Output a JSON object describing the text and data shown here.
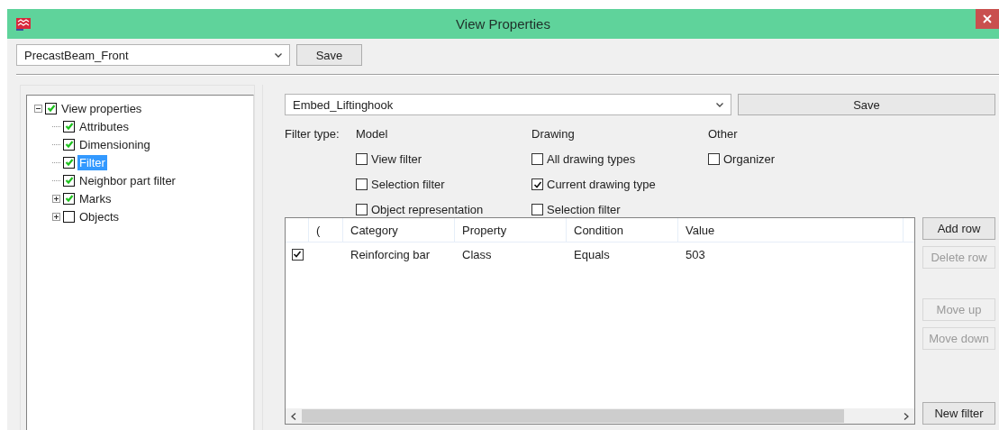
{
  "window": {
    "title": "View Properties"
  },
  "view_selector": {
    "value": "PrecastBeam_Front",
    "save": "Save"
  },
  "tree": [
    {
      "label": "View properties",
      "checked": true,
      "selected": false,
      "expanded": true,
      "children": [
        {
          "label": "Attributes",
          "checked": true,
          "selected": false
        },
        {
          "label": "Dimensioning",
          "checked": true,
          "selected": false
        },
        {
          "label": "Filter",
          "checked": true,
          "selected": true
        },
        {
          "label": "Neighbor part filter",
          "checked": true,
          "selected": false
        },
        {
          "label": "Marks",
          "checked": true,
          "selected": false,
          "expanded": false
        },
        {
          "label": "Objects",
          "checked": false,
          "selected": false,
          "expanded": false
        }
      ]
    }
  ],
  "filter_selector": {
    "value": "Embed_Liftinghook",
    "save": "Save"
  },
  "filter_type": {
    "label": "Filter type:",
    "groups": [
      {
        "heading": "Model",
        "options": [
          {
            "label": "View filter",
            "checked": false
          },
          {
            "label": "Selection filter",
            "checked": false
          },
          {
            "label": "Object representation",
            "checked": false
          }
        ]
      },
      {
        "heading": "Drawing",
        "options": [
          {
            "label": "All drawing types",
            "checked": false
          },
          {
            "label": "Current drawing type",
            "checked": true
          },
          {
            "label": "Selection filter",
            "checked": false
          }
        ]
      },
      {
        "heading": "Other",
        "options": [
          {
            "label": "Organizer",
            "checked": false
          }
        ]
      }
    ]
  },
  "table": {
    "columns": [
      "(",
      "Category",
      "Property",
      "Condition",
      "Value"
    ],
    "rows": [
      {
        "checked": true,
        "cells": [
          "",
          "Reinforcing bar",
          "Class",
          "Equals",
          "503"
        ]
      }
    ]
  },
  "side_buttons": [
    {
      "label": "Add row",
      "disabled": false
    },
    {
      "label": "Delete row",
      "disabled": true
    },
    {
      "label": "Move up",
      "disabled": true
    },
    {
      "label": "Move down",
      "disabled": true
    },
    {
      "label": "New filter",
      "disabled": false
    }
  ]
}
